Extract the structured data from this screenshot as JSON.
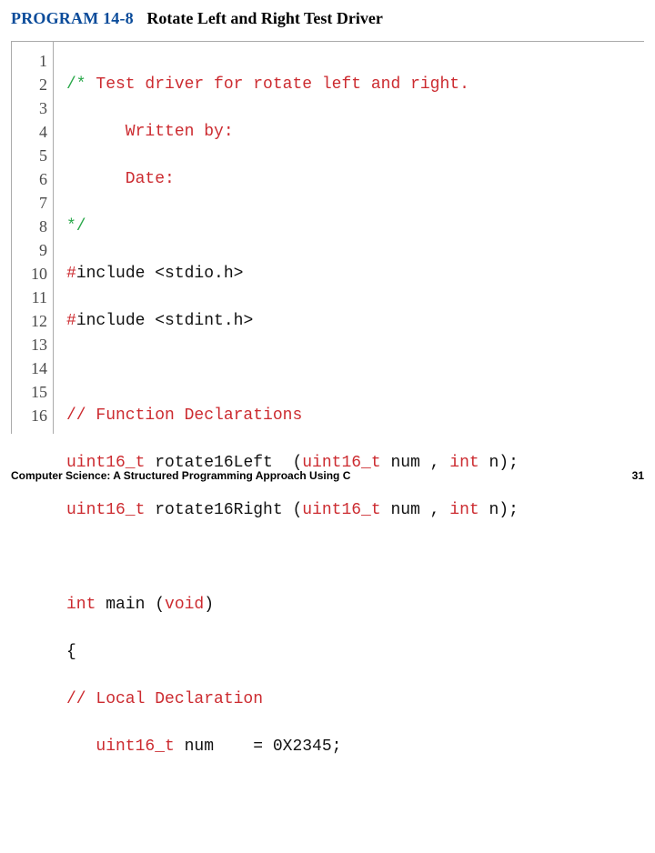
{
  "header": {
    "program_label": "PROGRAM 14-8",
    "title": "Rotate Left and Right Test Driver"
  },
  "code": {
    "gutter": [
      "1",
      "2",
      "3",
      "4",
      "5",
      "6",
      "7",
      "8",
      "9",
      "10",
      "11",
      "12",
      "13",
      "14",
      "15",
      "16"
    ],
    "lines": {
      "l1_a": "/* ",
      "l1_b": "Test driver for rotate left and right.",
      "l2": "      Written by:",
      "l3": "      Date:",
      "l4": "*/",
      "l5_a": "#",
      "l5_b": "include <stdio.h>",
      "l6_a": "#",
      "l6_b": "include <stdint.h>",
      "l7": "",
      "l8": "// Function Declarations",
      "l9_a": "uint16_t",
      "l9_b": " rotate16Left  (",
      "l9_c": "uint16_t",
      "l9_d": " num , ",
      "l9_e": "int",
      "l9_f": " n);",
      "l10_a": "uint16_t",
      "l10_b": " rotate16Right (",
      "l10_c": "uint16_t",
      "l10_d": " num , ",
      "l10_e": "int",
      "l10_f": " n);",
      "l11": "",
      "l12_a": "int",
      "l12_b": " main (",
      "l12_c": "void",
      "l12_d": ")",
      "l13": "{",
      "l14": "// Local Declaration",
      "l15_a": "   uint16_t",
      "l15_b": " num    = 0X2345;",
      "l16": ""
    }
  },
  "footer": {
    "left": "Computer Science: A Structured Programming Approach Using C",
    "right": "31"
  }
}
